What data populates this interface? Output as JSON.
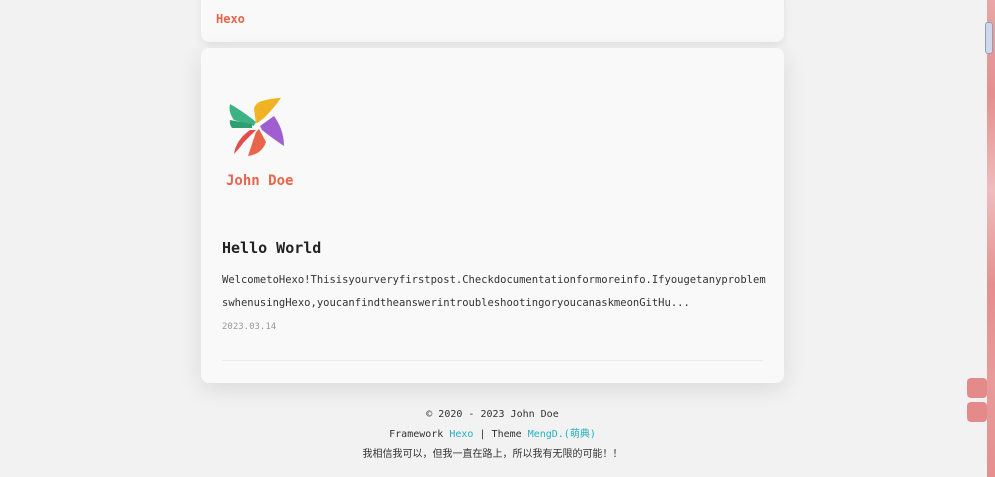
{
  "header": {
    "brand": "Hexo"
  },
  "profile": {
    "author_name": "John Doe",
    "logo_icon": "pinwheel-logo-icon"
  },
  "post": {
    "title": "Hello World",
    "excerpt": "WelcometoHexo!Thisisyourveryfirstpost.Checkdocumentationformoreinfo.IfyougetanyproblemswhenusingHexo,youcanfindtheanswerintroubleshootingoryoucanaskmeonGitHu...",
    "date": "2023.03.14"
  },
  "footer": {
    "copyright": "© 2020 - 2023 John Doe",
    "framework_label": "Framework",
    "framework_link": "Hexo",
    "separator": "|",
    "theme_label": "Theme",
    "theme_link": "MengD.(萌典)",
    "motto": "我相信我可以，但我一直在路上，所以我有无限的可能！！"
  },
  "colors": {
    "accent": "#e8644a",
    "link": "#22b0c0",
    "side_button": "#e58a8a"
  }
}
